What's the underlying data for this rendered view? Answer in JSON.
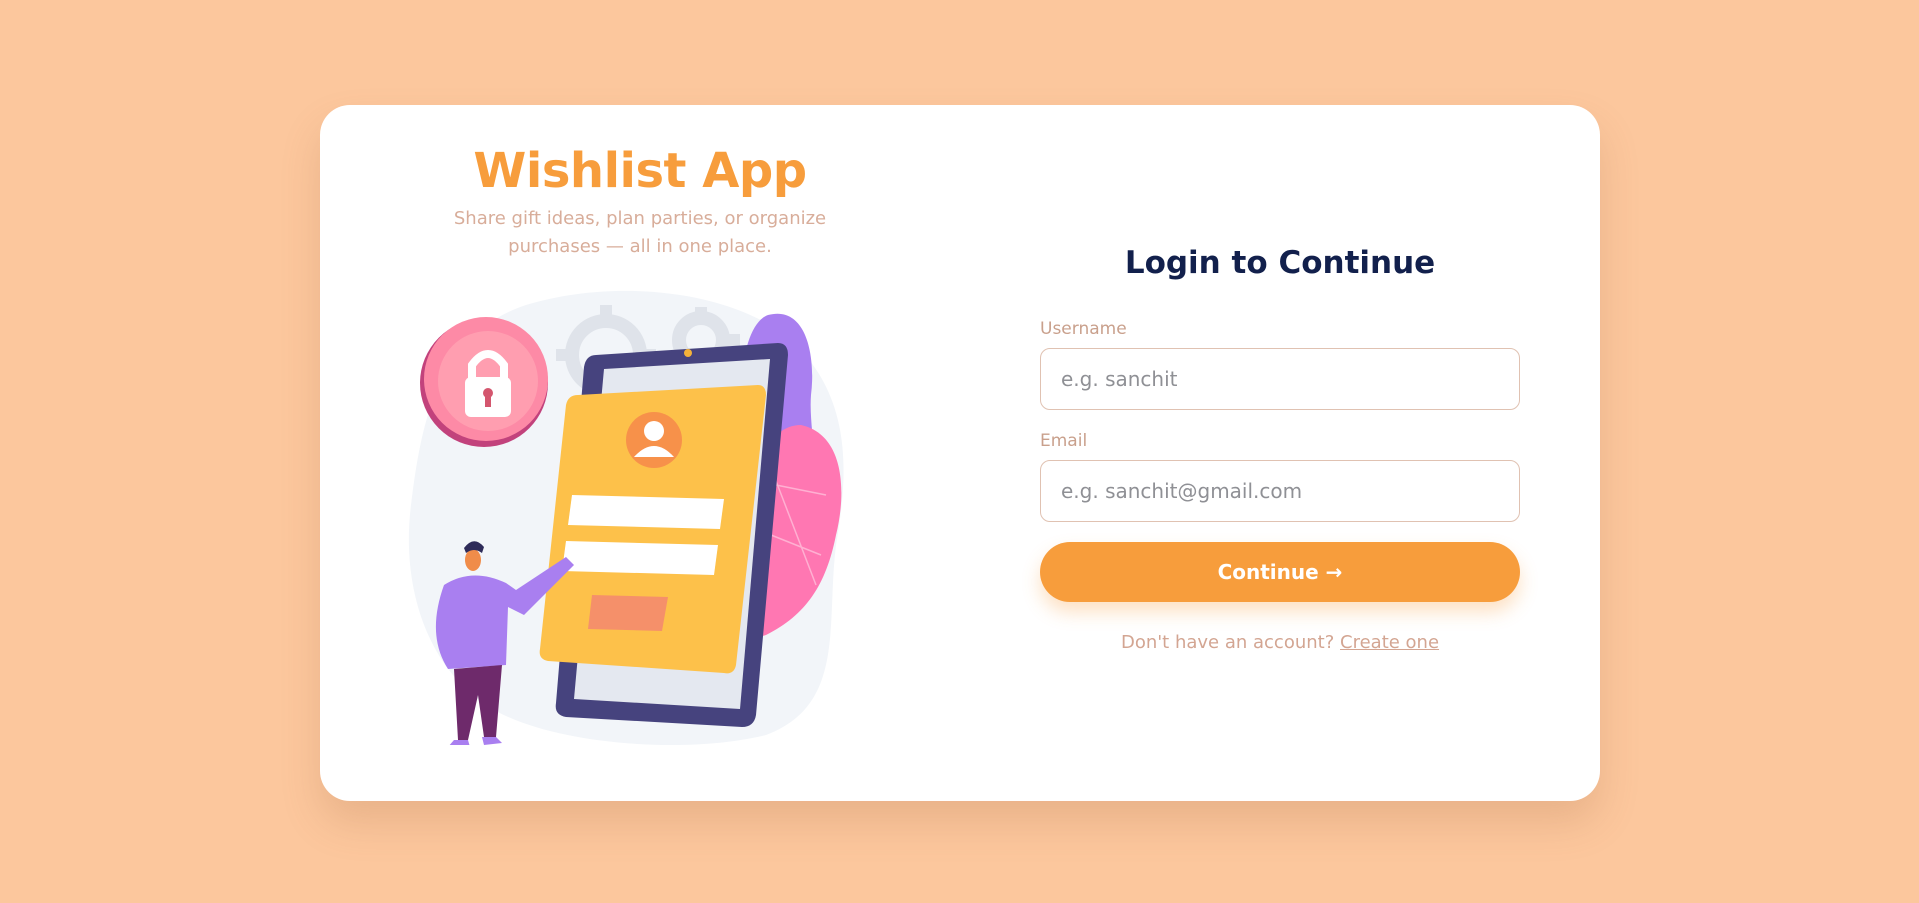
{
  "brand": {
    "title": "Wishlist App",
    "tagline": "Share gift ideas, plan parties, or organize purchases — all in one place."
  },
  "illustration": {
    "description_icon": "phone-login-illustration"
  },
  "form": {
    "title": "Login to Continue",
    "username_label": "Username",
    "username_placeholder": "e.g. sanchit",
    "username_value": "",
    "email_label": "Email",
    "email_placeholder": "e.g. sanchit@gmail.com",
    "email_value": "",
    "submit_label": "Continue →",
    "signup_prompt": "Don't have an account?",
    "signup_link": "Create one"
  },
  "colors": {
    "background": "#fcc79d",
    "accent": "#f79d3c",
    "heading": "#12204c",
    "muted": "#d3a592"
  }
}
